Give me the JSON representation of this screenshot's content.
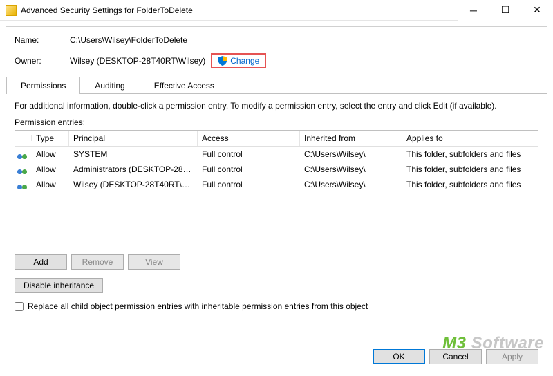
{
  "window": {
    "title": "Advanced Security Settings for FolderToDelete"
  },
  "fields": {
    "name_label": "Name:",
    "name_value": "C:\\Users\\Wilsey\\FolderToDelete",
    "owner_label": "Owner:",
    "owner_value": "Wilsey (DESKTOP-28T40RT\\Wilsey)",
    "change_label": "Change"
  },
  "tabs": {
    "permissions": "Permissions",
    "auditing": "Auditing",
    "effective": "Effective Access"
  },
  "info_line": "For additional information, double-click a permission entry. To modify a permission entry, select the entry and click Edit (if available).",
  "perm_header": "Permission entries:",
  "columns": {
    "type": "Type",
    "principal": "Principal",
    "access": "Access",
    "inherited": "Inherited from",
    "applies": "Applies to"
  },
  "rows": [
    {
      "type": "Allow",
      "principal": "SYSTEM",
      "access": "Full control",
      "inherited": "C:\\Users\\Wilsey\\",
      "applies": "This folder, subfolders and files"
    },
    {
      "type": "Allow",
      "principal": "Administrators (DESKTOP-28T...",
      "access": "Full control",
      "inherited": "C:\\Users\\Wilsey\\",
      "applies": "This folder, subfolders and files"
    },
    {
      "type": "Allow",
      "principal": "Wilsey (DESKTOP-28T40RT\\Wil...",
      "access": "Full control",
      "inherited": "C:\\Users\\Wilsey\\",
      "applies": "This folder, subfolders and files"
    }
  ],
  "buttons": {
    "add": "Add",
    "remove": "Remove",
    "view": "View",
    "disable": "Disable inheritance",
    "ok": "OK",
    "cancel": "Cancel",
    "apply": "Apply"
  },
  "checkbox_label": "Replace all child object permission entries with inheritable permission entries from this object",
  "watermark": {
    "brand": "M3",
    "rest": " Software"
  }
}
